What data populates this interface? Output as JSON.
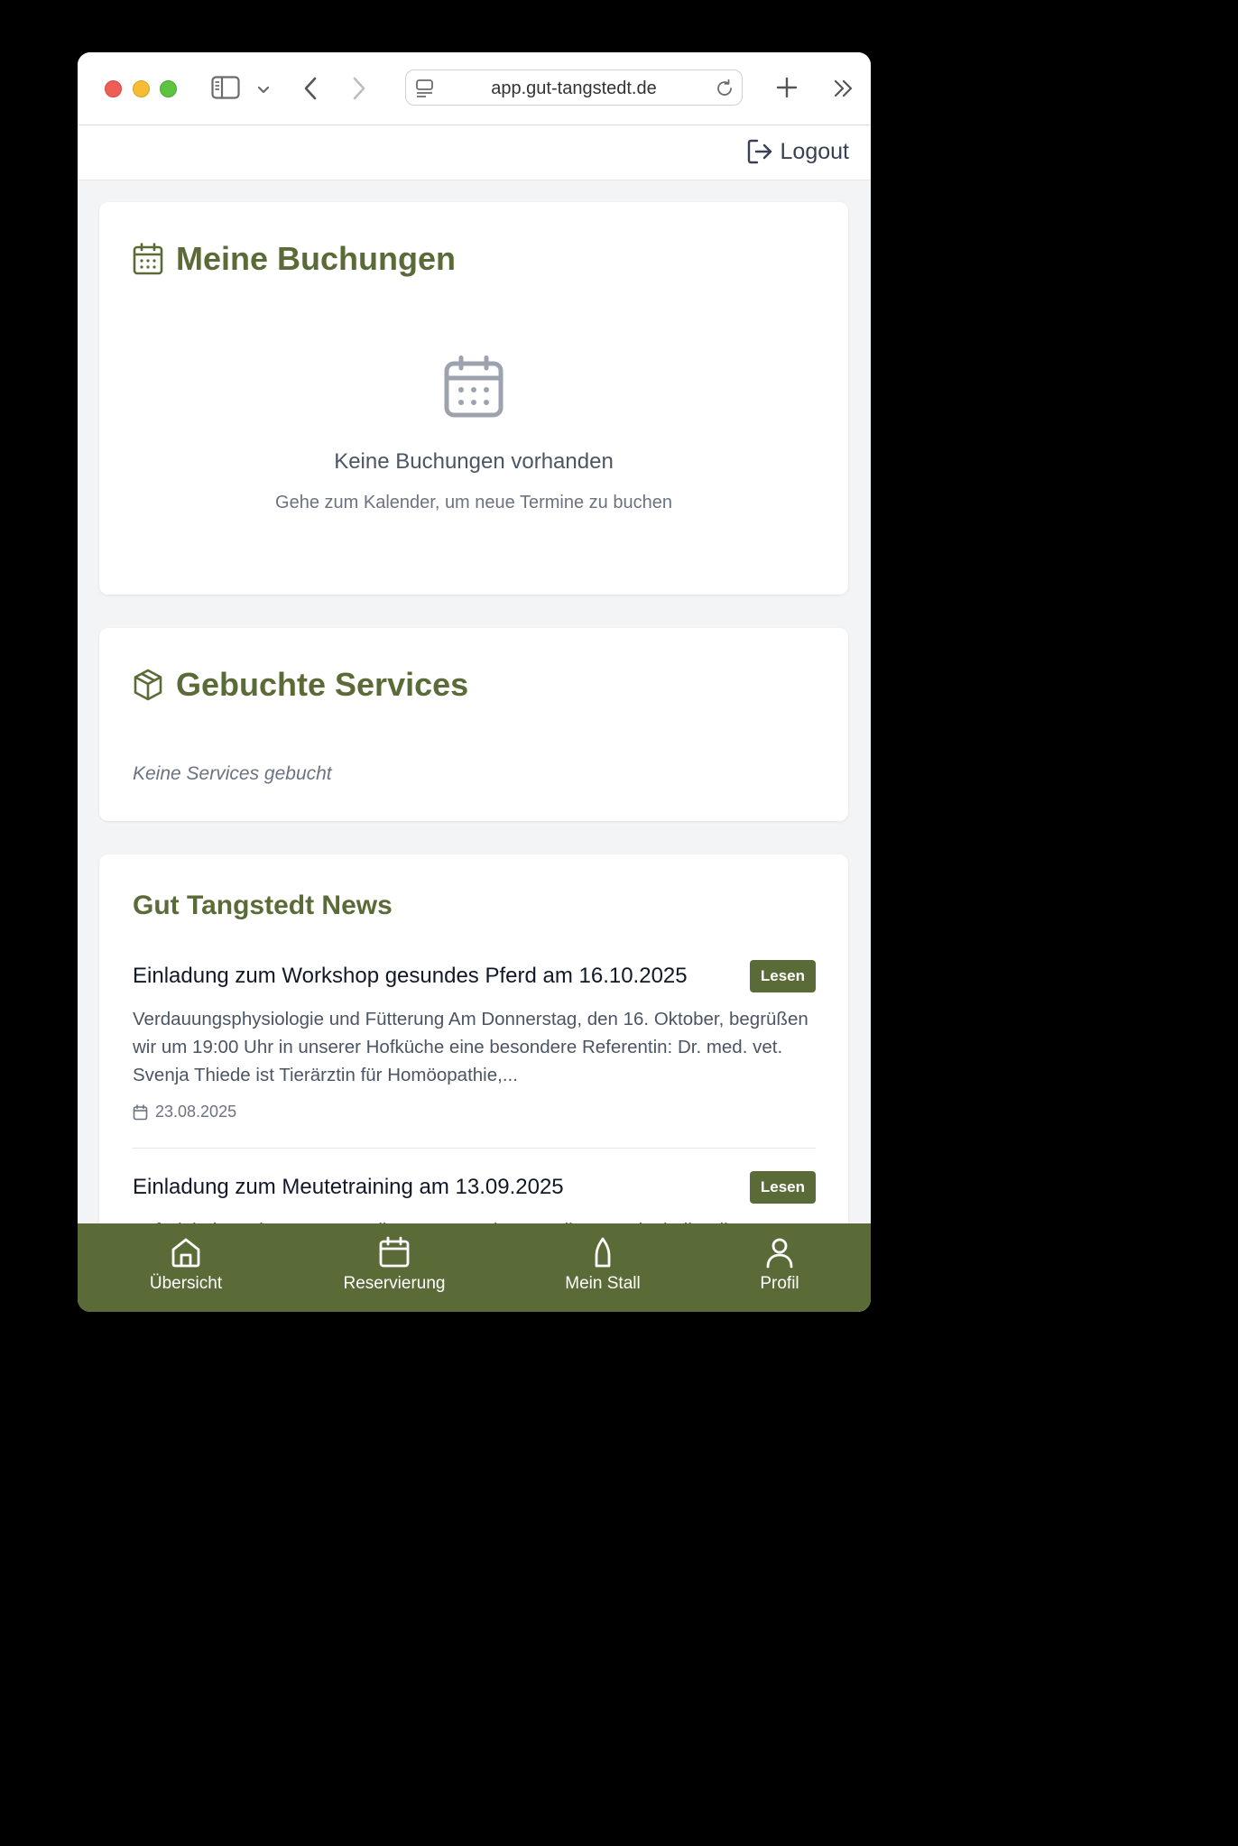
{
  "browser": {
    "url": "app.gut-tangstedt.de"
  },
  "header": {
    "logout_label": "Logout"
  },
  "bookings": {
    "title": "Meine Buchungen",
    "empty_title": "Keine Buchungen vorhanden",
    "empty_subtitle": "Gehe zum Kalender, um neue Termine zu buchen"
  },
  "services": {
    "title": "Gebuchte Services",
    "empty_text": "Keine Services gebucht"
  },
  "news": {
    "title": "Gut Tangstedt News",
    "items": [
      {
        "headline": "Einladung zum Workshop gesundes Pferd am 16.10.2025",
        "button_label": "Lesen",
        "excerpt": "Verdauungsphysiologie und Fütterung Am Donnerstag, den 16. Oktober, begrüßen wir um 19:00 Uhr in unserer Hofküche eine besondere Referentin: Dr. med. vet. Svenja Thiede ist Tierärztin für Homöopathie,...",
        "date": "23.08.2025"
      },
      {
        "headline": "Einladung zum Meutetraining am 13.09.2025",
        "button_label": "Lesen",
        "excerpt": "Auf Einladung der Peter, Caroline, Peter und Peter Silas vermittelt die Bil..."
      }
    ]
  },
  "nav": {
    "items": [
      {
        "label": "Übersicht",
        "icon": "home-icon"
      },
      {
        "label": "Reservierung",
        "icon": "calendar-icon"
      },
      {
        "label": "Mein Stall",
        "icon": "stall-icon"
      },
      {
        "label": "Profil",
        "icon": "user-icon"
      }
    ]
  },
  "colors": {
    "brand_green": "#5b6b38",
    "page_background": "#f3f4f6"
  }
}
